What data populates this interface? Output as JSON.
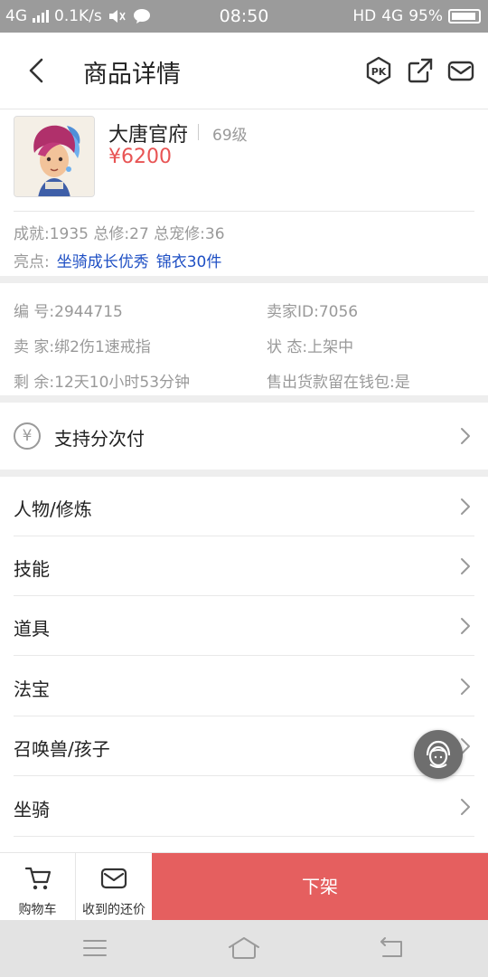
{
  "status_bar": {
    "network_left": "4G",
    "speed": "0.1K/s",
    "time": "08:50",
    "hd": "HD",
    "network_right": "4G",
    "battery": "95%"
  },
  "header": {
    "title": "商品详情",
    "icons": [
      "back-icon",
      "pk-icon",
      "share-icon",
      "mail-icon"
    ]
  },
  "product": {
    "server": "大唐官府",
    "level": "69级",
    "price": "¥6200",
    "stats": "成就:1935 总修:27 总宠修:36",
    "highlight_label": "亮点:",
    "highlights": [
      "坐骑成长优秀",
      "锦衣30件"
    ]
  },
  "info": {
    "number": "编  号:2944715",
    "seller_id": "卖家ID:7056",
    "seller": "卖  家:绑2伤1速戒指",
    "status": "状  态:上架中",
    "remaining": "剩  余:12天10小时53分钟",
    "wallet": "售出货款留在钱包:是"
  },
  "installment": {
    "icon": "yen-icon",
    "yen_glyph": "¥",
    "label": "支持分次付"
  },
  "menu": [
    {
      "label": "人物/修炼"
    },
    {
      "label": "技能"
    },
    {
      "label": "道具"
    },
    {
      "label": "法宝"
    },
    {
      "label": "召唤兽/孩子"
    },
    {
      "label": "坐骑"
    }
  ],
  "bottom_bar": {
    "cart_label": "购物车",
    "offers_label": "收到的还价",
    "delist_label": "下架"
  },
  "colors": {
    "accent_red": "#e55f5f",
    "price_red": "#e85454",
    "link_blue": "#1e4fc4",
    "status_bar": "#9b9b9b"
  }
}
